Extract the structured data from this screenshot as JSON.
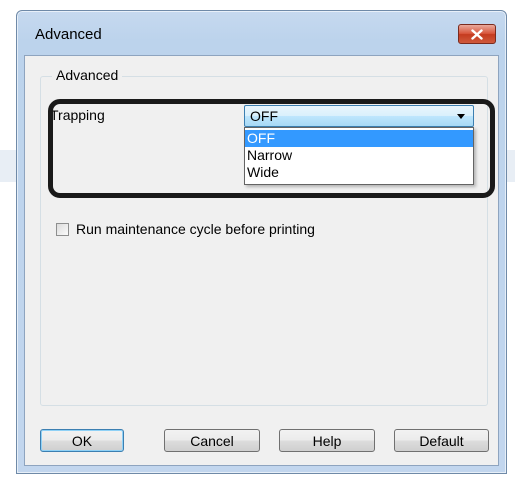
{
  "window": {
    "title": "Advanced",
    "close_icon": "close-icon"
  },
  "group": {
    "legend": "Advanced"
  },
  "trapping": {
    "label": "Trapping",
    "selected": "OFF",
    "options": [
      "OFF",
      "Narrow",
      "Wide"
    ],
    "highlighted_option": "OFF"
  },
  "maintenance": {
    "label": "Run maintenance cycle before printing",
    "checked": false
  },
  "buttons": {
    "ok": "OK",
    "cancel": "Cancel",
    "help": "Help",
    "default": "Default"
  },
  "colors": {
    "selection": "#3399ff",
    "close_button": "#c43b1f",
    "callout_frame": "#1a1a1a"
  }
}
